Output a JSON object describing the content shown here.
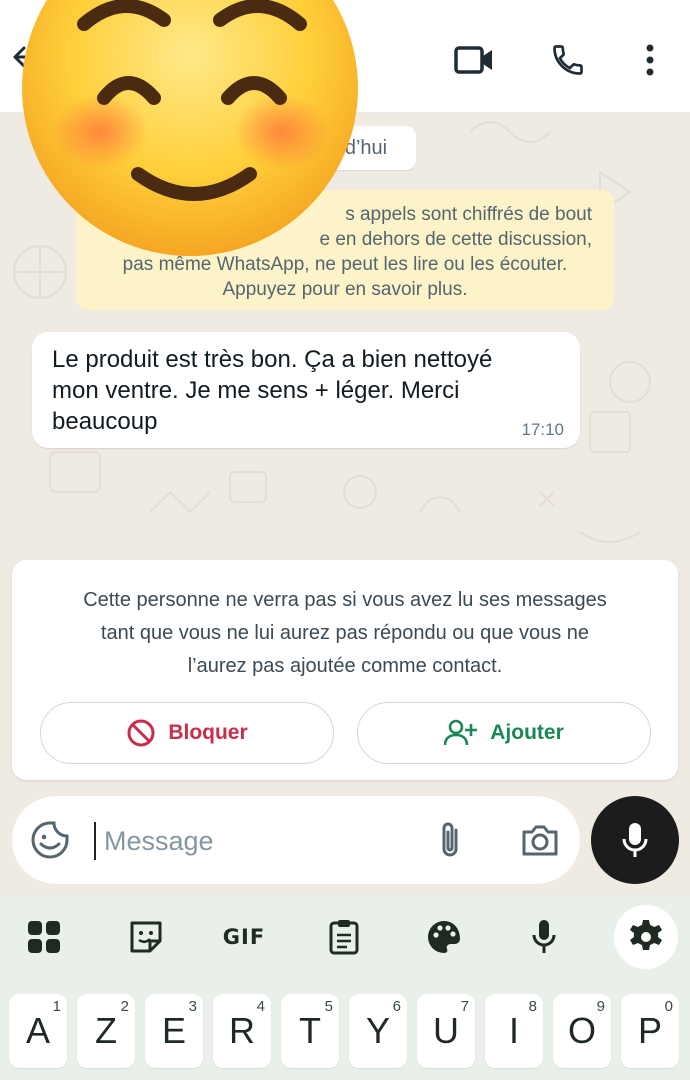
{
  "header": {
    "icons": [
      "back-arrow-icon",
      "video-call-icon",
      "voice-call-icon",
      "more-options-icon"
    ]
  },
  "chat": {
    "date_chip": "d’hui",
    "encryption_notice": {
      "lines": [
        "s appels sont chiffrés de bout",
        "e en dehors de cette discussion,",
        "pas même WhatsApp, ne peut les lire ou les écouter.",
        "Appuyez pour en savoir plus."
      ]
    },
    "message": {
      "text": "Le produit est très bon. Ça a bien nettoyé mon ventre. Je me sens + léger. Merci beaucoup",
      "time": "17:10"
    },
    "unknown_contact_card": {
      "lines": [
        "Cette personne ne verra pas si vous avez lu ses messages",
        "tant que vous ne lui aurez pas répondu ou que vous ne",
        "l’aurez pas ajoutée comme contact."
      ],
      "block_label": "Bloquer",
      "add_label": "Ajouter"
    }
  },
  "input_bar": {
    "placeholder": "Message"
  },
  "keyboard": {
    "toolbar": [
      "apps-grid-icon",
      "sticker-icon",
      "GIF",
      "clipboard-icon",
      "palette-icon",
      "voice-input-icon",
      "settings-gear-icon"
    ],
    "gif_label": "GIF",
    "keys": [
      {
        "letter": "A",
        "num": "1"
      },
      {
        "letter": "Z",
        "num": "2"
      },
      {
        "letter": "E",
        "num": "3"
      },
      {
        "letter": "R",
        "num": "4"
      },
      {
        "letter": "T",
        "num": "5"
      },
      {
        "letter": "Y",
        "num": "6"
      },
      {
        "letter": "U",
        "num": "7"
      },
      {
        "letter": "I",
        "num": "8"
      },
      {
        "letter": "O",
        "num": "9"
      },
      {
        "letter": "P",
        "num": "0"
      }
    ]
  },
  "colors": {
    "wallpaper": "#efeae2",
    "notice_bg": "#fdf3c9",
    "block_red": "#c92e4a",
    "add_green": "#1b8755",
    "keyboard_bg": "#e9efe9"
  }
}
